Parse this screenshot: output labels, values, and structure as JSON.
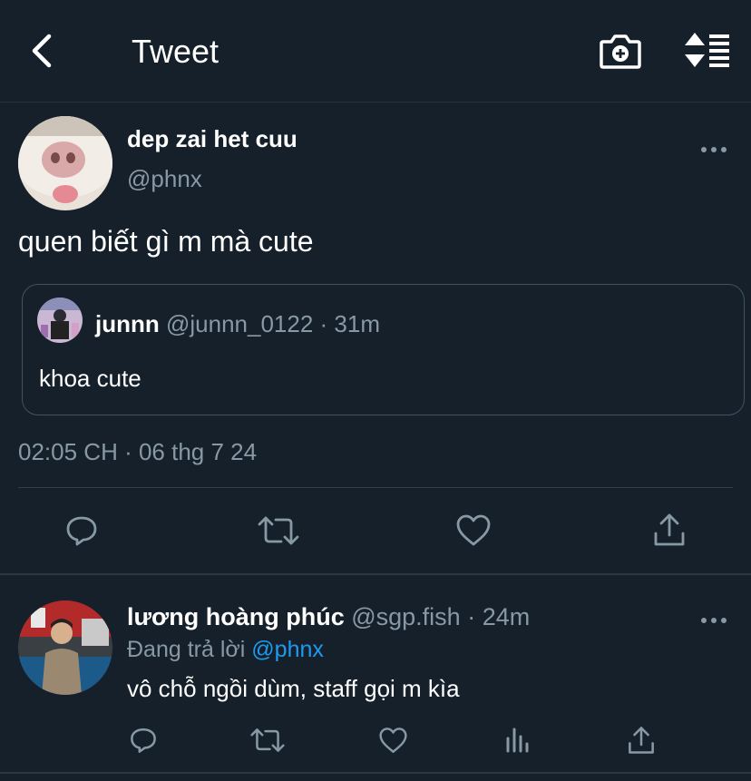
{
  "header": {
    "title": "Tweet",
    "back_icon": "chevron-left-icon",
    "camera_icon": "camera-plus-icon",
    "sort_icon": "sort-list-icon"
  },
  "tweet": {
    "display_name": "dep zai het cuu",
    "handle": "@phnx",
    "text": "quen biết gì m mà cute",
    "timestamp": "02:05 CH · 06 thg 7 24",
    "quote": {
      "name": "junnn",
      "handle": "@junnn_0122",
      "time": "· 31m",
      "text": "khoa cute"
    },
    "actions": [
      "reply-icon",
      "retweet-icon",
      "like-icon",
      "share-icon"
    ]
  },
  "reply": {
    "name": "lương hoàng phúc",
    "handle": "@sgp.fish",
    "time": "· 24m",
    "replying_prefix": "Đang trả lời",
    "replying_to": "@phnx",
    "text": "vô chỗ ngồi dùm, staff gọi m kìa",
    "actions": [
      "reply-icon",
      "retweet-icon",
      "like-icon",
      "analytics-icon",
      "share-icon"
    ]
  },
  "colors": {
    "background": "#15202b",
    "secondary_text": "#8899a6",
    "link": "#1d9bf0",
    "border": "#3d5466"
  }
}
